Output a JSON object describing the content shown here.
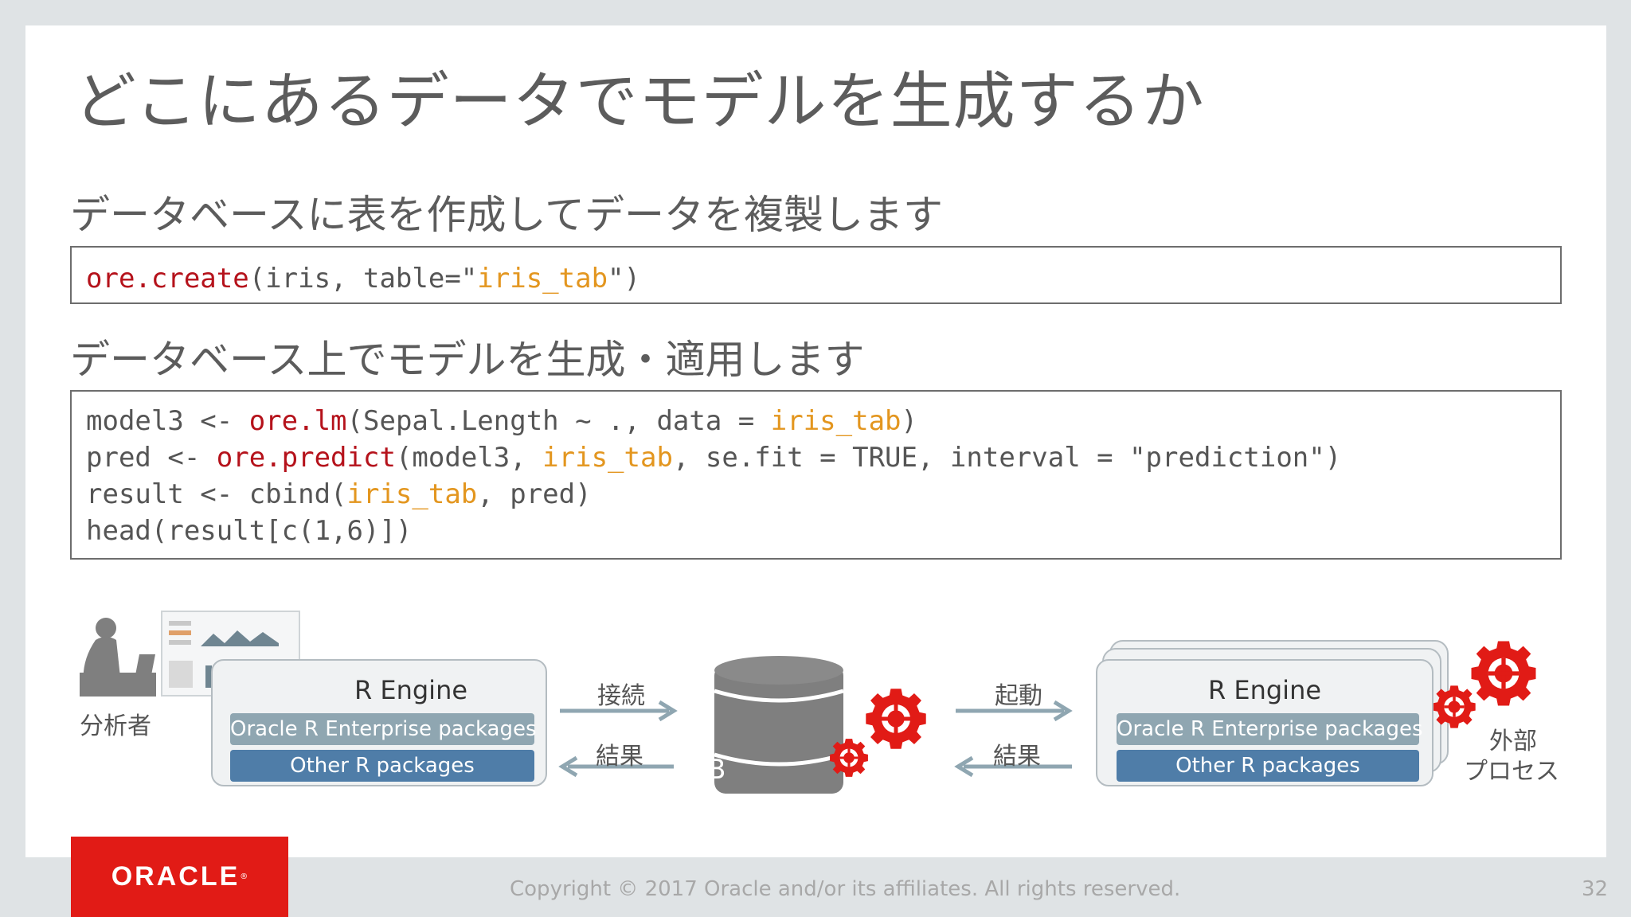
{
  "slide": {
    "title": "どこにあるデータでモデルを生成するか",
    "subhead1": "データベースに表を作成してデータを複製します",
    "subhead2": "データベース上でモデルを生成・適用します",
    "code1": {
      "fn": "ore.create",
      "mid": "(iris, table=\"",
      "tbl": "iris_tab",
      "end": "\")"
    },
    "code2": {
      "line1": {
        "a": "model3 <- ",
        "fn": "ore.lm",
        "b": "(Sepal.Length ~ ., data = ",
        "tbl": "iris_tab",
        "c": ")"
      },
      "line2": {
        "a": "pred <- ",
        "fn": "ore.predict",
        "b": "(model3, ",
        "tbl": "iris_tab",
        "c": ", se.fit = TRUE, interval = \"prediction\")"
      },
      "line3": {
        "a": "result <- cbind(",
        "tbl": "iris_tab",
        "c": ", pred)"
      },
      "line4": "head(result[c(1,6)])"
    }
  },
  "diagram": {
    "analyst_label": "分析者",
    "left_engine": {
      "title": "R Engine",
      "pkg1": "Oracle R Enterprise packages",
      "pkg2": "Other R packages"
    },
    "connect_label": "接続",
    "result_label_left": "結果",
    "db_label": "DB",
    "launch_label": "起動",
    "result_label_right": "結果",
    "right_engine": {
      "title": "R Engine",
      "pkg1": "Oracle R Enterprise packages",
      "pkg2": "Other R packages"
    },
    "external_label_1": "外部",
    "external_label_2": "プロセス"
  },
  "footer": {
    "copyright": "Copyright © 2017 Oracle and/or its affiliates.  All rights reserved.",
    "page": "32",
    "logo": "ORACLE"
  },
  "colors": {
    "accent_red": "#e11b16",
    "code_keyword": "#b5121b",
    "code_table": "#e3961f",
    "pkg_ore": "#8fa6b1",
    "pkg_other": "#4f7da8"
  }
}
